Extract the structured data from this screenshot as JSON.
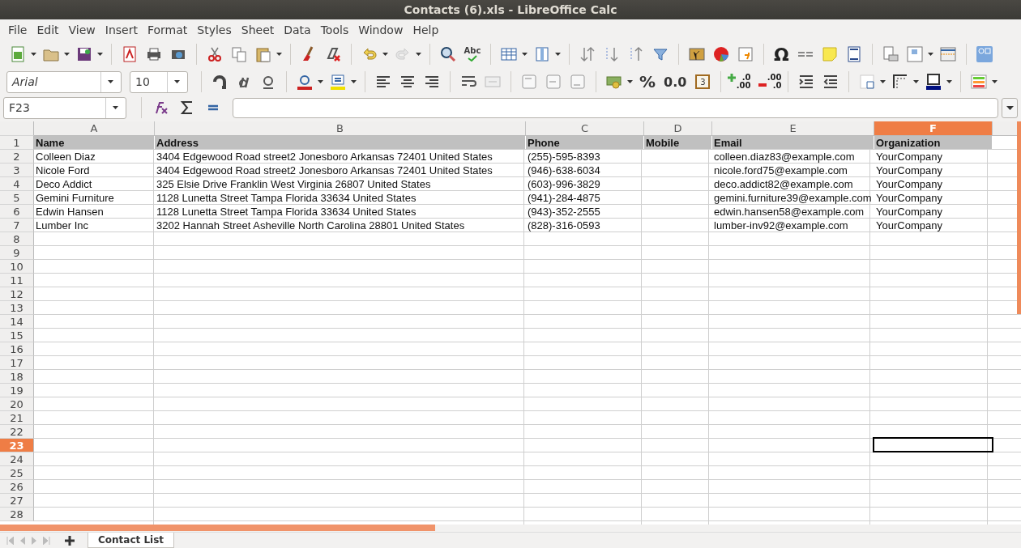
{
  "window": {
    "title": "Contacts (6).xls - LibreOffice Calc"
  },
  "menu": [
    "File",
    "Edit",
    "View",
    "Insert",
    "Format",
    "Styles",
    "Sheet",
    "Data",
    "Tools",
    "Window",
    "Help"
  ],
  "standard_toolbar": {
    "spelling_icon_text": "Abc",
    "special_character": "Ω"
  },
  "formatting_toolbar": {
    "font_name": "Arial",
    "font_size": "10",
    "percent": "%",
    "number_format": "0.0",
    "date_icon_text": "3",
    "add_decimal": [
      ".0",
      ".00"
    ],
    "delete_decimal": [
      ".00",
      ".0"
    ]
  },
  "formula_bar": {
    "name_box": "F23"
  },
  "columns": [
    {
      "label": "A",
      "selected": false
    },
    {
      "label": "B",
      "selected": false
    },
    {
      "label": "C",
      "selected": false
    },
    {
      "label": "D",
      "selected": false
    },
    {
      "label": "E",
      "selected": false
    },
    {
      "label": "F",
      "selected": true
    }
  ],
  "rows": [
    {
      "number": "1",
      "selected": false,
      "kind": "header",
      "cells": [
        "Name",
        "Address",
        "Phone",
        "Mobile",
        "Email",
        "Organization"
      ]
    },
    {
      "number": "2",
      "selected": false,
      "kind": "data",
      "cells": [
        "Colleen Diaz",
        "3404  Edgewood Road street2 Jonesboro Arkansas 72401 United States",
        "(255)-595-8393",
        "",
        "colleen.diaz83@example.com",
        "YourCompany"
      ]
    },
    {
      "number": "3",
      "selected": false,
      "kind": "data",
      "cells": [
        "Nicole Ford",
        "3404  Edgewood Road street2 Jonesboro Arkansas 72401 United States",
        "(946)-638-6034",
        "",
        "nicole.ford75@example.com",
        "YourCompany"
      ]
    },
    {
      "number": "4",
      "selected": false,
      "kind": "data",
      "cells": [
        "Deco Addict",
        "325 Elsie Drive Franklin West Virginia 26807 United States",
        "(603)-996-3829",
        "",
        "deco.addict82@example.com",
        "YourCompany"
      ]
    },
    {
      "number": "5",
      "selected": false,
      "kind": "data",
      "cells": [
        "Gemini Furniture",
        "1128 Lunetta Street Tampa Florida 33634 United States",
        "(941)-284-4875",
        "",
        "gemini.furniture39@example.com",
        "YourCompany"
      ]
    },
    {
      "number": "6",
      "selected": false,
      "kind": "data",
      "cells": [
        "Edwin Hansen",
        "1128 Lunetta Street Tampa Florida 33634 United States",
        "(943)-352-2555",
        "",
        "edwin.hansen58@example.com",
        "YourCompany"
      ]
    },
    {
      "number": "7",
      "selected": false,
      "kind": "data",
      "cells": [
        "Lumber Inc",
        "3202  Hannah Street Asheville North Carolina 28801 United States",
        "(828)-316-0593",
        "",
        "lumber-inv92@example.com",
        "YourCompany"
      ]
    },
    {
      "number": "8",
      "selected": false
    },
    {
      "number": "9",
      "selected": false
    },
    {
      "number": "10",
      "selected": false
    },
    {
      "number": "11",
      "selected": false
    },
    {
      "number": "12",
      "selected": false
    },
    {
      "number": "13",
      "selected": false
    },
    {
      "number": "14",
      "selected": false
    },
    {
      "number": "15",
      "selected": false
    },
    {
      "number": "16",
      "selected": false
    },
    {
      "number": "17",
      "selected": false
    },
    {
      "number": "18",
      "selected": false
    },
    {
      "number": "19",
      "selected": false
    },
    {
      "number": "20",
      "selected": false
    },
    {
      "number": "21",
      "selected": false
    },
    {
      "number": "22",
      "selected": false
    },
    {
      "number": "23",
      "selected": true
    },
    {
      "number": "24",
      "selected": false
    },
    {
      "number": "25",
      "selected": false
    },
    {
      "number": "26",
      "selected": false
    },
    {
      "number": "27",
      "selected": false
    },
    {
      "number": "28",
      "selected": false
    }
  ],
  "sheet_tabs": [
    {
      "label": "Contact List",
      "selected": true
    }
  ]
}
